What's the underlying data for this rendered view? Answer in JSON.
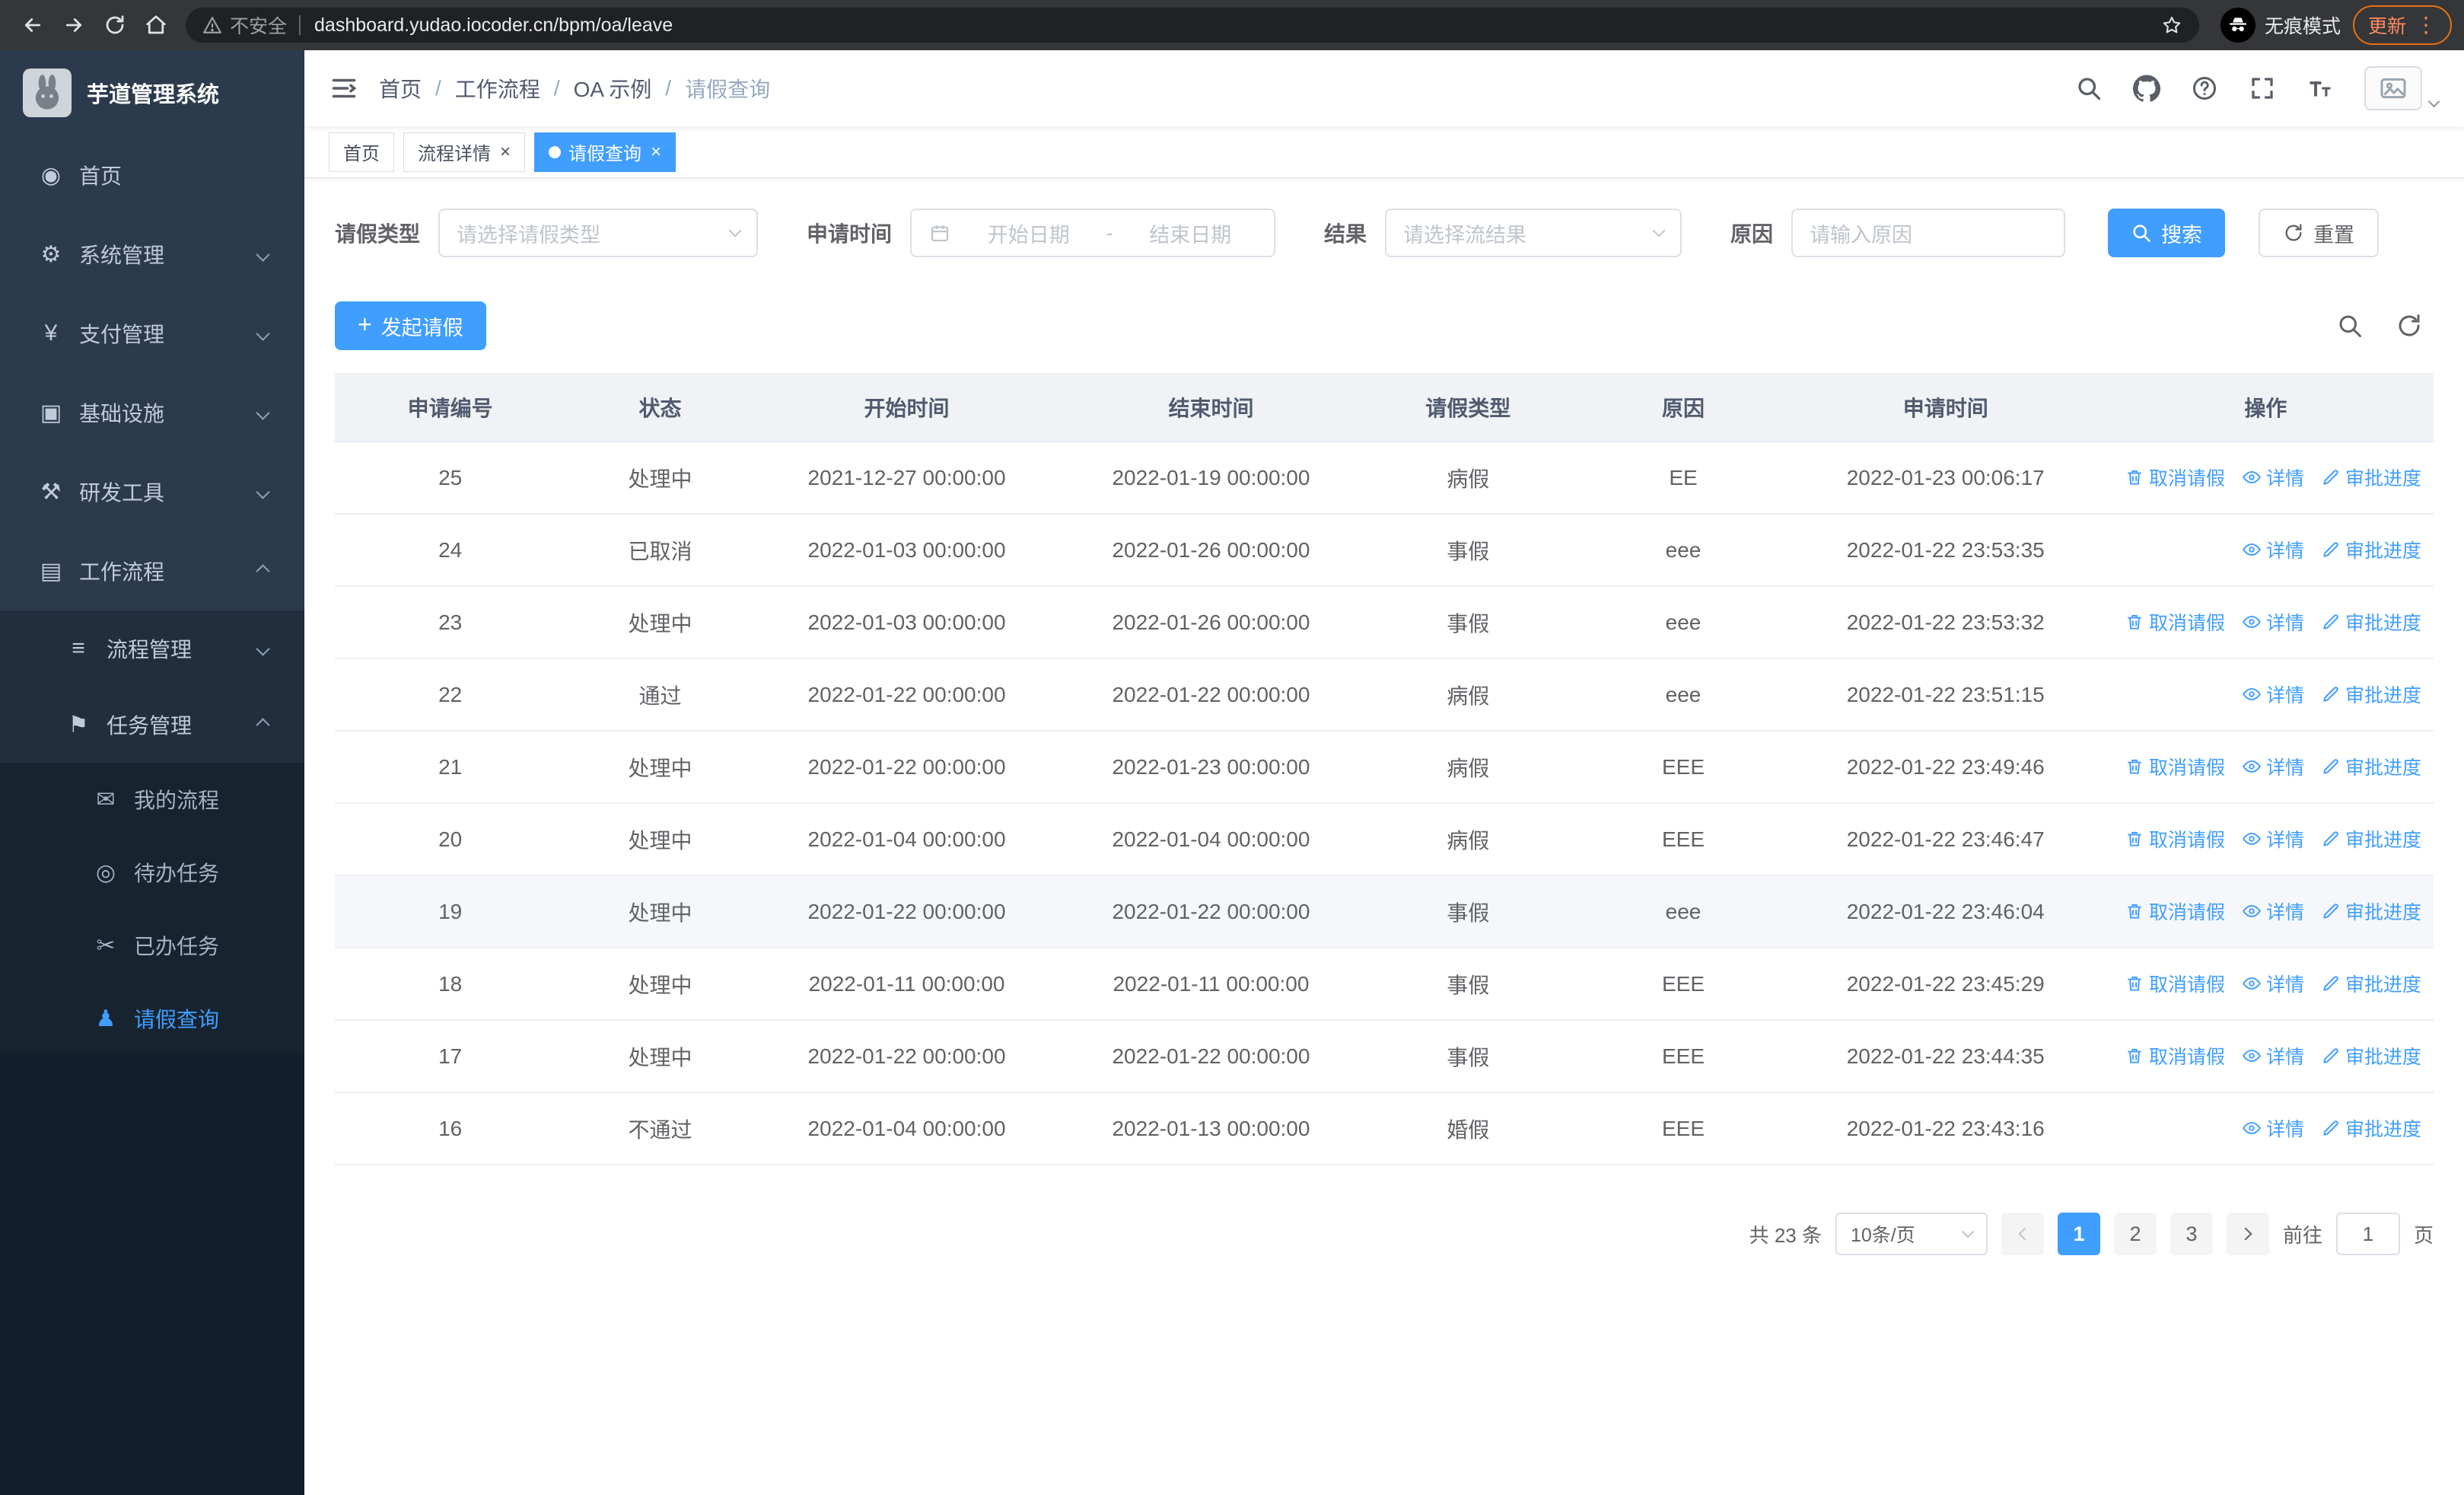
{
  "colors": {
    "primary": "#409EFF",
    "sidebar_bg": "#141F2D",
    "chrome_bg": "#35363A",
    "update_accent": "#FF8B60"
  },
  "browser": {
    "security_label": "不安全",
    "url": "dashboard.yudao.iocoder.cn/bpm/oa/leave",
    "incognito_label": "无痕模式",
    "update_label": "更新"
  },
  "sidebar": {
    "title": "芋道管理系统",
    "items": [
      {
        "name": "home",
        "label": "首页",
        "icon": "dashboard-icon",
        "glyph": "◉",
        "depth": 0,
        "chevron": null,
        "active": false
      },
      {
        "name": "system-mgmt",
        "label": "系统管理",
        "icon": "gear-icon",
        "glyph": "⚙",
        "depth": 0,
        "chevron": "down",
        "active": false
      },
      {
        "name": "payment-mgmt",
        "label": "支付管理",
        "icon": "yen-icon",
        "glyph": "¥",
        "depth": 0,
        "chevron": "down",
        "active": false
      },
      {
        "name": "infrastructure",
        "label": "基础设施",
        "icon": "infra-icon",
        "glyph": "▣",
        "depth": 0,
        "chevron": "down",
        "active": false
      },
      {
        "name": "dev-tools",
        "label": "研发工具",
        "icon": "tools-icon",
        "glyph": "⚒",
        "depth": 0,
        "chevron": "down",
        "active": false
      },
      {
        "name": "workflow",
        "label": "工作流程",
        "icon": "briefcase-icon",
        "glyph": "▤",
        "depth": 0,
        "chevron": "up",
        "active": false
      },
      {
        "name": "process-mgmt",
        "label": "流程管理",
        "icon": "list-icon",
        "glyph": "≡",
        "depth": 1,
        "chevron": "down",
        "active": false
      },
      {
        "name": "task-mgmt",
        "label": "任务管理",
        "icon": "flag-icon",
        "glyph": "⚑",
        "depth": 1,
        "chevron": "up",
        "active": false
      },
      {
        "name": "my-process",
        "label": "我的流程",
        "icon": "message-icon",
        "glyph": "✉",
        "depth": 2,
        "chevron": null,
        "active": false
      },
      {
        "name": "todo-tasks",
        "label": "待办任务",
        "icon": "eye-icon",
        "glyph": "◎",
        "depth": 2,
        "chevron": null,
        "active": false
      },
      {
        "name": "done-tasks",
        "label": "已办任务",
        "icon": "scissors-icon",
        "glyph": "✂",
        "depth": 2,
        "chevron": null,
        "active": false
      },
      {
        "name": "leave-query",
        "label": "请假查询",
        "icon": "user-icon",
        "glyph": "♟",
        "depth": 2,
        "chevron": null,
        "active": true
      }
    ]
  },
  "navbar": {
    "breadcrumb": [
      "首页",
      "工作流程",
      "OA 示例",
      "请假查询"
    ]
  },
  "tabs": [
    {
      "name": "home",
      "label": "首页",
      "closable": false,
      "active": false
    },
    {
      "name": "process-detail",
      "label": "流程详情",
      "closable": true,
      "active": false
    },
    {
      "name": "leave-query",
      "label": "请假查询",
      "closable": true,
      "active": true
    }
  ],
  "filters": {
    "leave_type_label": "请假类型",
    "leave_type_placeholder": "请选择请假类型",
    "apply_time_label": "申请时间",
    "start_placeholder": "开始日期",
    "range_separator": "-",
    "end_placeholder": "结束日期",
    "result_label": "结果",
    "result_placeholder": "请选择流结果",
    "reason_label": "原因",
    "reason_placeholder": "请输入原因",
    "search_label": "搜索",
    "reset_label": "重置"
  },
  "toolbar": {
    "create_label": "发起请假"
  },
  "table": {
    "columns": [
      "申请编号",
      "状态",
      "开始时间",
      "结束时间",
      "请假类型",
      "原因",
      "申请时间",
      "操作"
    ],
    "action_labels": {
      "cancel": "取消请假",
      "detail": "详情",
      "progress": "审批进度"
    },
    "rows": [
      {
        "id": "25",
        "status": "处理中",
        "start": "2021-12-27 00:00:00",
        "end": "2022-01-19 00:00:00",
        "type": "病假",
        "reason": "EE",
        "applied": "2022-01-23 00:06:17",
        "actions": [
          "cancel",
          "detail",
          "progress"
        ],
        "highlight": false
      },
      {
        "id": "24",
        "status": "已取消",
        "start": "2022-01-03 00:00:00",
        "end": "2022-01-26 00:00:00",
        "type": "事假",
        "reason": "eee",
        "applied": "2022-01-22 23:53:35",
        "actions": [
          "detail",
          "progress"
        ],
        "highlight": false
      },
      {
        "id": "23",
        "status": "处理中",
        "start": "2022-01-03 00:00:00",
        "end": "2022-01-26 00:00:00",
        "type": "事假",
        "reason": "eee",
        "applied": "2022-01-22 23:53:32",
        "actions": [
          "cancel",
          "detail",
          "progress"
        ],
        "highlight": false
      },
      {
        "id": "22",
        "status": "通过",
        "start": "2022-01-22 00:00:00",
        "end": "2022-01-22 00:00:00",
        "type": "病假",
        "reason": "eee",
        "applied": "2022-01-22 23:51:15",
        "actions": [
          "detail",
          "progress"
        ],
        "highlight": false
      },
      {
        "id": "21",
        "status": "处理中",
        "start": "2022-01-22 00:00:00",
        "end": "2022-01-23 00:00:00",
        "type": "病假",
        "reason": "EEE",
        "applied": "2022-01-22 23:49:46",
        "actions": [
          "cancel",
          "detail",
          "progress"
        ],
        "highlight": false
      },
      {
        "id": "20",
        "status": "处理中",
        "start": "2022-01-04 00:00:00",
        "end": "2022-01-04 00:00:00",
        "type": "病假",
        "reason": "EEE",
        "applied": "2022-01-22 23:46:47",
        "actions": [
          "cancel",
          "detail",
          "progress"
        ],
        "highlight": false
      },
      {
        "id": "19",
        "status": "处理中",
        "start": "2022-01-22 00:00:00",
        "end": "2022-01-22 00:00:00",
        "type": "事假",
        "reason": "eee",
        "applied": "2022-01-22 23:46:04",
        "actions": [
          "cancel",
          "detail",
          "progress"
        ],
        "highlight": true
      },
      {
        "id": "18",
        "status": "处理中",
        "start": "2022-01-11 00:00:00",
        "end": "2022-01-11 00:00:00",
        "type": "事假",
        "reason": "EEE",
        "applied": "2022-01-22 23:45:29",
        "actions": [
          "cancel",
          "detail",
          "progress"
        ],
        "highlight": false
      },
      {
        "id": "17",
        "status": "处理中",
        "start": "2022-01-22 00:00:00",
        "end": "2022-01-22 00:00:00",
        "type": "事假",
        "reason": "EEE",
        "applied": "2022-01-22 23:44:35",
        "actions": [
          "cancel",
          "detail",
          "progress"
        ],
        "highlight": false
      },
      {
        "id": "16",
        "status": "不通过",
        "start": "2022-01-04 00:00:00",
        "end": "2022-01-13 00:00:00",
        "type": "婚假",
        "reason": "EEE",
        "applied": "2022-01-22 23:43:16",
        "actions": [
          "detail",
          "progress"
        ],
        "highlight": false
      }
    ]
  },
  "pagination": {
    "total": "共 23 条",
    "page_size": "10条/页",
    "pages": [
      "1",
      "2",
      "3"
    ],
    "active_page": "1",
    "goto_label": "前往",
    "goto_value": "1",
    "page_unit": "页"
  }
}
